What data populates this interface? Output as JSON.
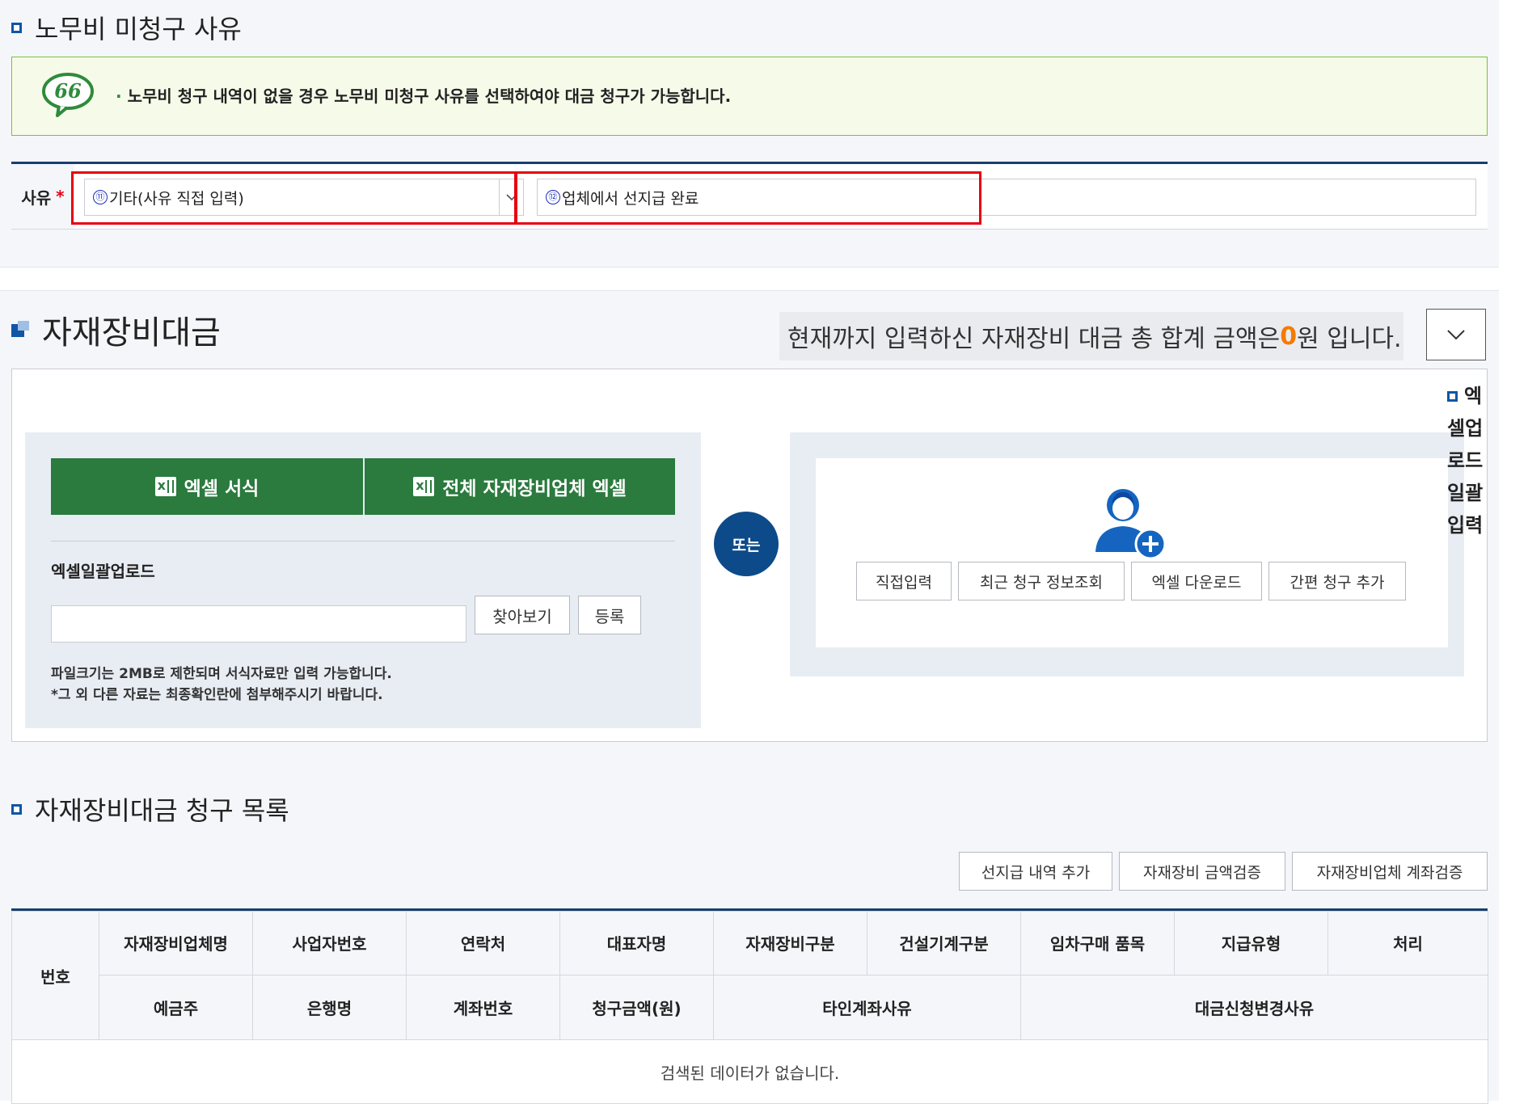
{
  "labor": {
    "title": "노무비 미청구 사유",
    "notice": "노무비 청구 내역이 없을 경우 노무비 미청구 사유를 선택하여야 대금 청구가 가능합니다.",
    "notice_icon": "quote-bubble-icon",
    "reason_label": "사유",
    "required_mark": "*",
    "marker_11": "⑪",
    "marker_12": "⑫",
    "reason_select_value": "기타(사유 직접 입력)",
    "reason_text_value": "업체에서 선지급 완료"
  },
  "material": {
    "title": "자재장비대금",
    "total_prefix": "현재까지 입력하신 자재장비 대금 총 합계 금액은 ",
    "total_value": "0",
    "total_suffix": "원 입니다.",
    "excel_form_button": "엑셀 서식",
    "all_vendor_excel_button": "전체 자재장비업체 엑셀",
    "upload_label": "엑셀일괄업로드",
    "browse_button": "찾아보기",
    "register_button": "등록",
    "note1": "파일크기는 2MB로 제한되며 서식자료만 입력 가능합니다.",
    "note2": "*그 외 다른 자료는 최종확인란에 첨부해주시기 바랍니다.",
    "or_label": "또는",
    "direct_input_button": "직접입력",
    "recent_claim_button": "최근 청구 정보조회",
    "excel_download_button": "엑셀 다운로드",
    "simple_claim_button": "간편 청구 추가"
  },
  "side_note": {
    "line1": "엑",
    "line2": "셀",
    "line3": "업",
    "line4": "로",
    "line5": "드",
    "line6": "일",
    "line7": "괄",
    "line8": "입",
    "line9": "력"
  },
  "claims": {
    "title": "자재장비대금 청구 목록",
    "prepay_add_button": "선지급 내역 추가",
    "amount_verify_button": "자재장비 금액검증",
    "account_verify_button": "자재장비업체 계좌검증",
    "header_row1": [
      "자재장비업체명",
      "사업자번호",
      "연락처",
      "대표자명",
      "자재장비구분",
      "건설기계구분",
      "임차구매 품목",
      "지급유형",
      "처리"
    ],
    "header_row2_a": [
      "예금주",
      "은행명",
      "계좌번호",
      "청구금액(원)"
    ],
    "header_no": "번호",
    "header_other_account": "타인계좌사유",
    "header_change_reason": "대금신청변경사유",
    "empty_message": "검색된 데이터가 없습니다."
  },
  "colors": {
    "accent_blue": "#1155a5",
    "dark_navy": "#0d4a8a",
    "excel_green": "#2b7a3e",
    "highlight_red": "#e60012",
    "total_orange": "#f47b00"
  }
}
